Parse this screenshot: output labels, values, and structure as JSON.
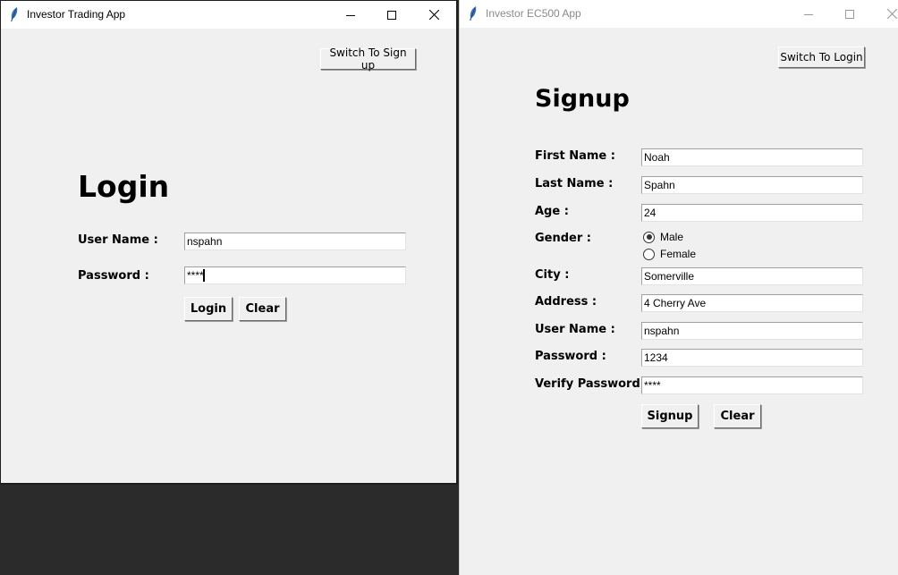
{
  "login_window": {
    "title": "Investor Trading App",
    "app_icon": "feather-icon",
    "window_controls": [
      "minimize",
      "maximize",
      "close"
    ],
    "switch_button": "Switch To Sign up",
    "heading": "Login",
    "fields": {
      "username": {
        "label": "User Name :",
        "value": "nspahn"
      },
      "password": {
        "label": "Password :",
        "value": "****"
      }
    },
    "buttons": {
      "login": "Login",
      "clear": "Clear"
    }
  },
  "signup_window": {
    "title": "Investor EC500 App",
    "app_icon": "feather-icon",
    "window_controls": [
      "minimize",
      "maximize",
      "close"
    ],
    "switch_button": "Switch To Login",
    "heading": "Signup",
    "fields": {
      "first_name": {
        "label": "First Name :",
        "value": "Noah"
      },
      "last_name": {
        "label": "Last Name :",
        "value": "Spahn"
      },
      "age": {
        "label": "Age :",
        "value": "24"
      },
      "gender": {
        "label": "Gender :",
        "options": [
          "Male",
          "Female"
        ],
        "selected": "Male"
      },
      "city": {
        "label": "City :",
        "value": "Somerville"
      },
      "address": {
        "label": "Address :",
        "value": "4 Cherry Ave"
      },
      "username": {
        "label": "User Name :",
        "value": "nspahn"
      },
      "password": {
        "label": "Password :",
        "value": "1234"
      },
      "verify_password": {
        "label": "Verify Password",
        "value": "****"
      }
    },
    "buttons": {
      "signup": "Signup",
      "clear": "Clear"
    }
  }
}
